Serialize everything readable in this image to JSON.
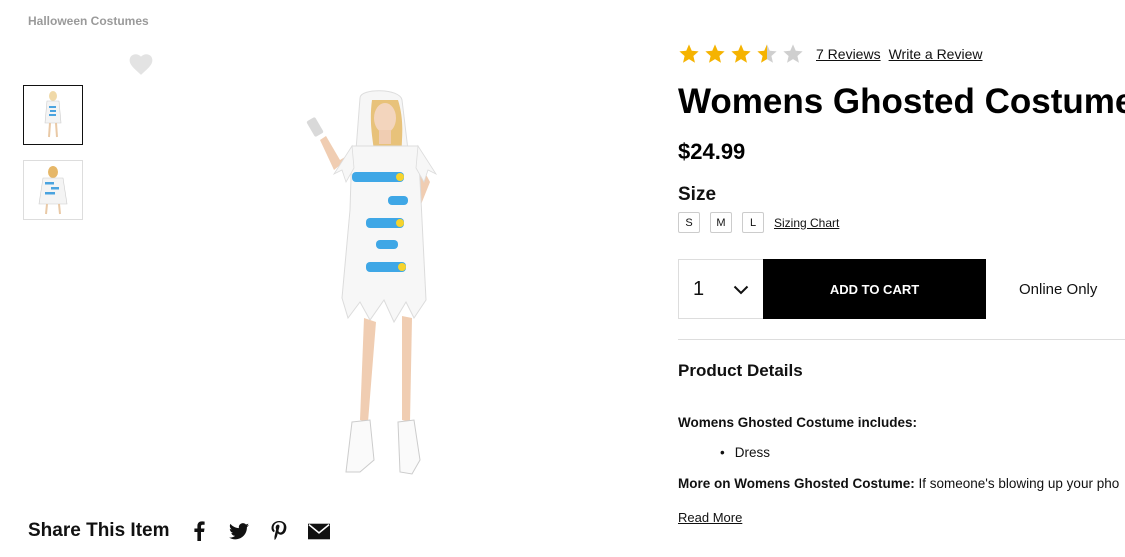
{
  "breadcrumb": "Halloween Costumes",
  "product": {
    "rating": 3.5,
    "rating_max": 5,
    "reviews_label": "7 Reviews",
    "write_review_label": "Write a Review",
    "title": "Womens Ghosted Costume",
    "price": "$24.99"
  },
  "size": {
    "label": "Size",
    "options": [
      "S",
      "M",
      "L"
    ],
    "sizing_chart_label": "Sizing Chart"
  },
  "purchase": {
    "quantity": "1",
    "add_to_cart_label": "ADD TO CART",
    "availability": "Online Only"
  },
  "details": {
    "title": "Product Details",
    "includes_title": "Womens Ghosted Costume includes:",
    "includes_items": [
      "Dress"
    ],
    "more_on_label": "More on Womens Ghosted Costume:",
    "more_on_text": " If someone's blowing up your pho",
    "read_more_label": "Read More"
  },
  "share": {
    "title": "Share This Item",
    "icons": [
      "facebook-icon",
      "twitter-icon",
      "pinterest-icon",
      "email-icon"
    ]
  },
  "colors": {
    "star_filled": "#f5b301",
    "star_empty": "#cfcfcf",
    "cart_button": "#000000"
  }
}
